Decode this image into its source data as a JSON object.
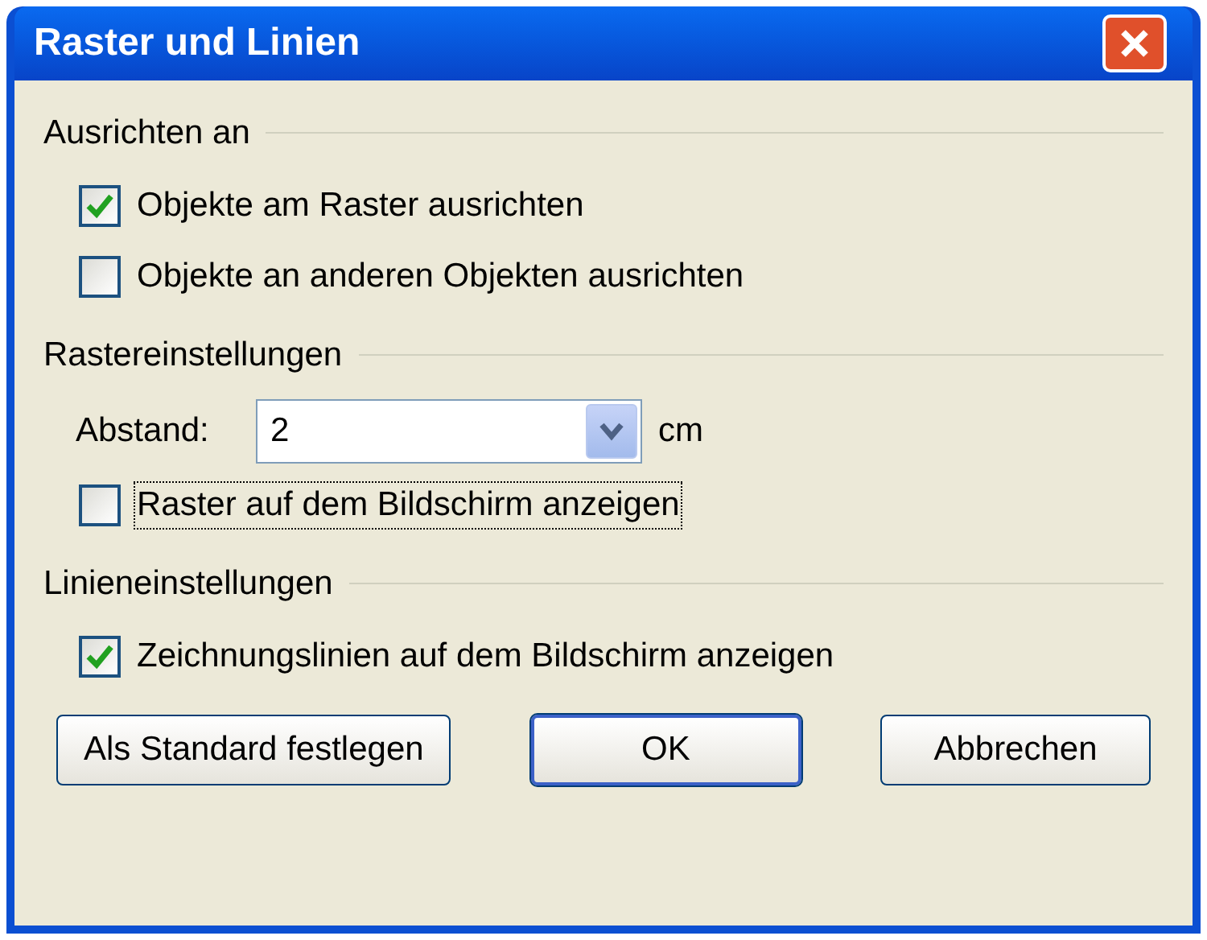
{
  "window": {
    "title": "Raster und Linien"
  },
  "sections": [
    {
      "heading": "Ausrichten an",
      "items": [
        {
          "kind": "checkbox",
          "label": "Objekte am Raster ausrichten",
          "checked": true,
          "focused": false
        },
        {
          "kind": "checkbox",
          "label": "Objekte an anderen Objekten ausrichten",
          "checked": false,
          "focused": false
        }
      ]
    },
    {
      "heading": "Rastereinstellungen",
      "items": [
        {
          "kind": "select",
          "label": "Abstand:",
          "value": "2",
          "unit": "cm"
        },
        {
          "kind": "checkbox",
          "label": "Raster auf dem Bildschirm anzeigen",
          "checked": false,
          "focused": true
        }
      ]
    },
    {
      "heading": "Linieneinstellungen",
      "items": [
        {
          "kind": "checkbox",
          "label": "Zeichnungslinien auf dem Bildschirm anzeigen",
          "checked": true,
          "focused": false
        }
      ]
    }
  ],
  "buttons": [
    {
      "label": "Als Standard festlegen",
      "default": false
    },
    {
      "label": "OK",
      "default": true
    },
    {
      "label": "Abbrechen",
      "default": false
    }
  ]
}
